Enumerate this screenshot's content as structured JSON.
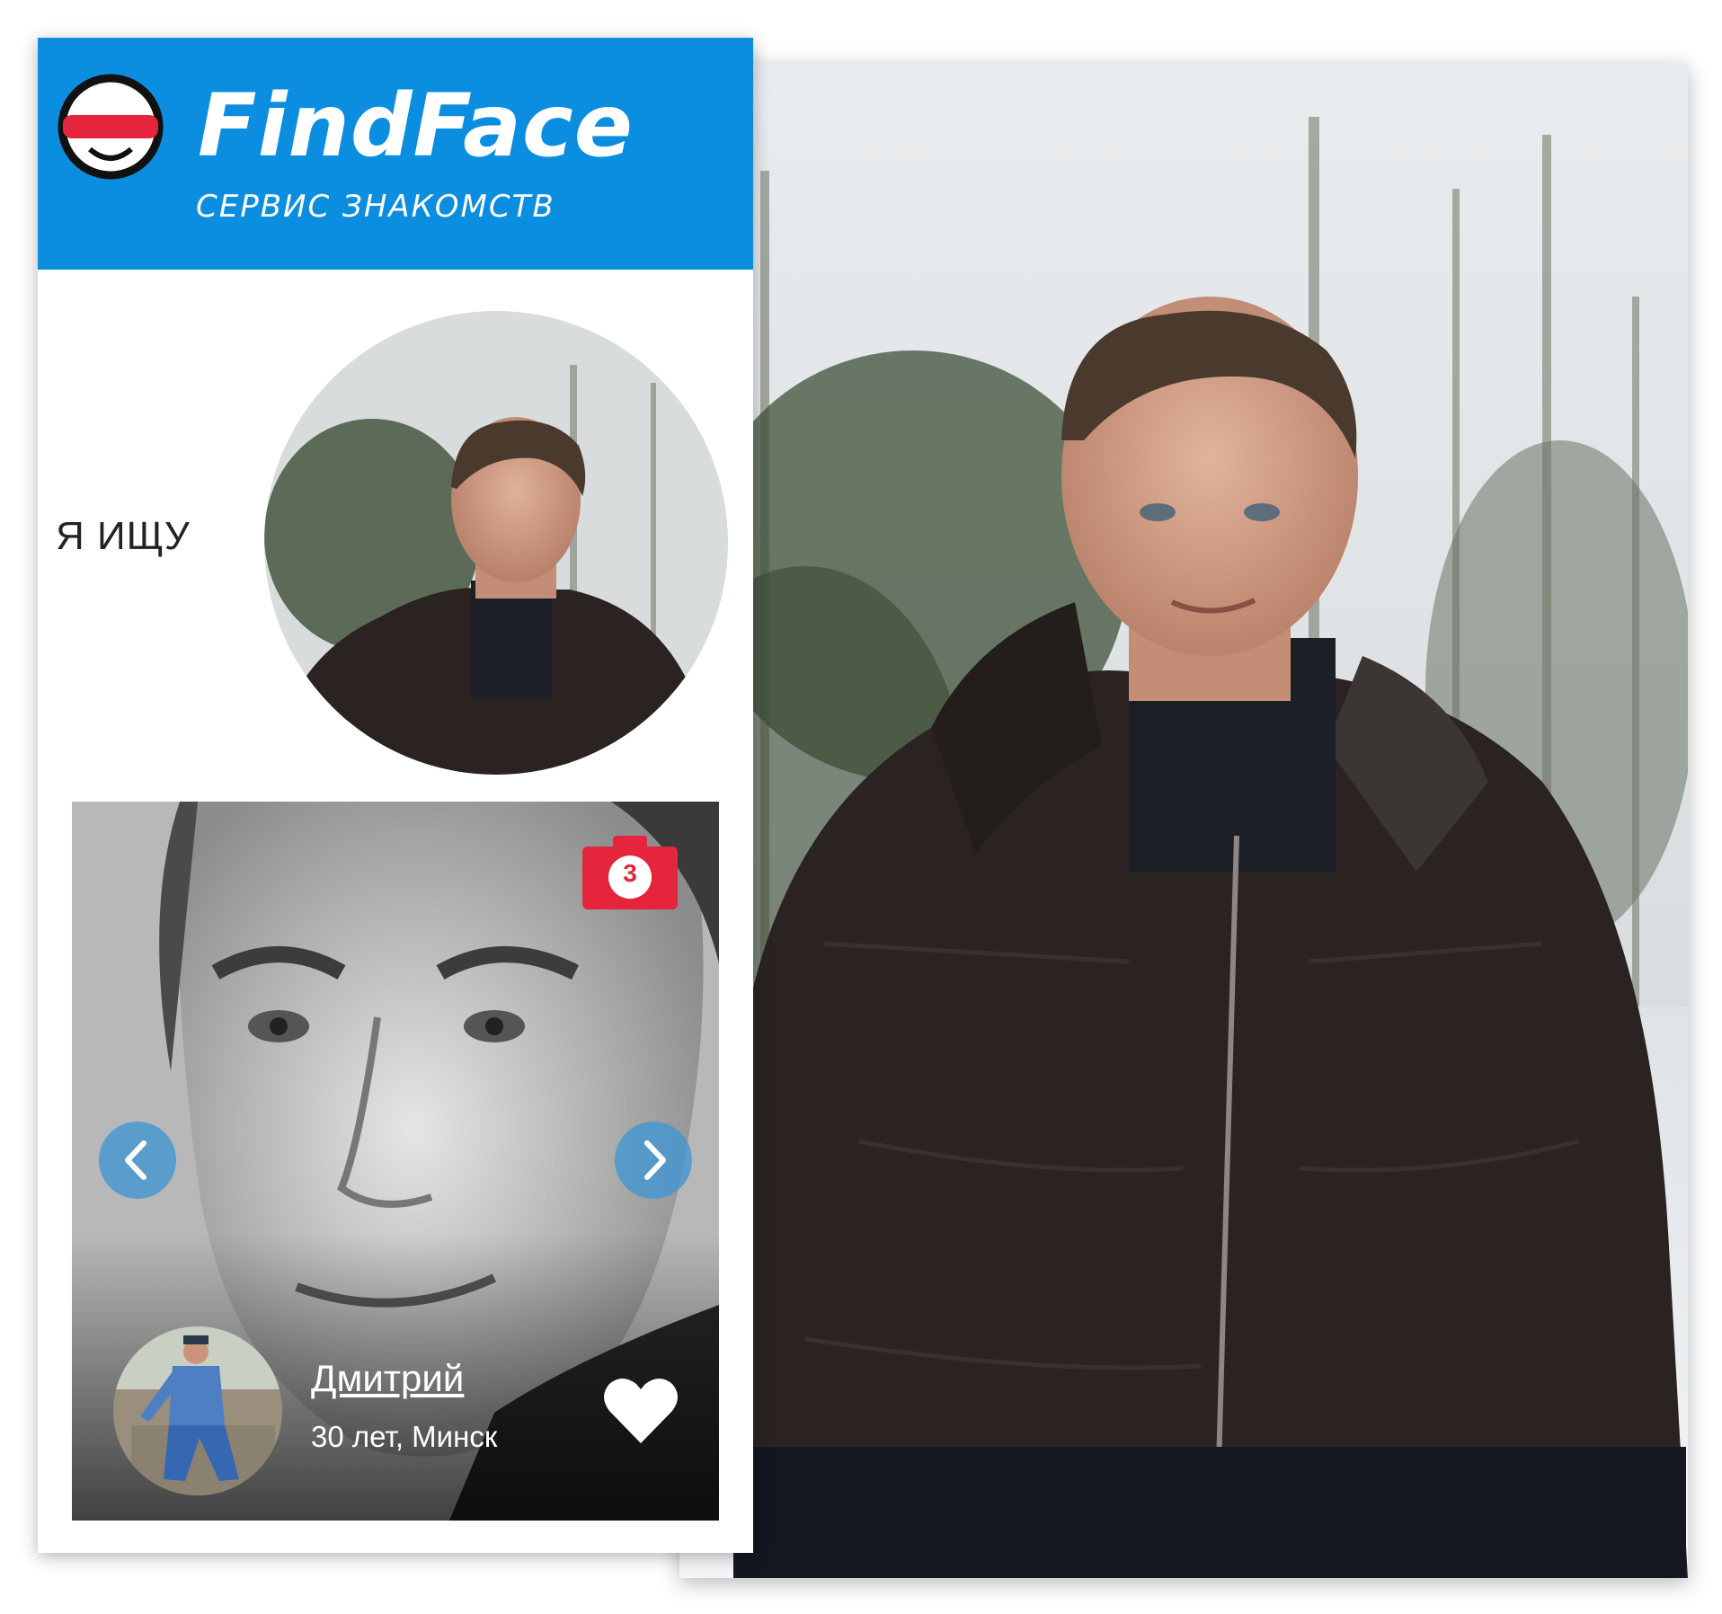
{
  "header": {
    "logo_text": "FindFace",
    "brand": "FindFace",
    "tagline": "СЕРВИС ЗНАКОМСТВ"
  },
  "search": {
    "label": "Я ИЩУ"
  },
  "result_card": {
    "photo_count": "3",
    "name": "Дмитрий",
    "details": "30 лет, Минск"
  },
  "icons": {
    "camera": "camera-icon",
    "prev": "chevron-left-icon",
    "next": "chevron-right-icon",
    "like": "heart-icon"
  },
  "colors": {
    "brand_blue": "#0b8de0",
    "accent_red": "#e5253b",
    "arrow_blue": "#4096d2"
  }
}
